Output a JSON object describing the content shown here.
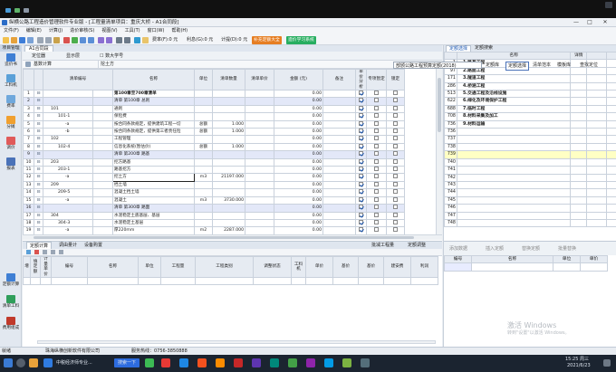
{
  "title_bar": {
    "title": "纵横公路工程造价管理软件专业版 - [工程量清单项目：重庆大桥 - A1合同段]",
    "controls": [
      "—",
      "□",
      "✕"
    ]
  },
  "menu": [
    "文件(F)",
    "编辑(E)",
    "计算(J)",
    "造价审核(S)",
    "视图(V)",
    "工具(T)",
    "窗口(W)",
    "帮助(H)"
  ],
  "toolbar": {
    "rate_label": "费率(F):0 元",
    "interest_label": "利息(G):0 元",
    "deduct_label": "计提(D):0 元",
    "btn_help": "补充定额大全",
    "btn_learn": "造价学习系统"
  },
  "left_nav": {
    "header": "项目管理",
    "items": [
      {
        "label": "造价书",
        "icon": "book-icon"
      },
      {
        "label": "工料机",
        "icon": "cart-icon"
      },
      {
        "label": "费率",
        "icon": "calc-icon"
      },
      {
        "label": "分摊",
        "icon": "share-icon"
      },
      {
        "label": "调价",
        "icon": "adjust-icon"
      },
      {
        "label": "报表",
        "icon": "report-icon"
      }
    ],
    "bottom_items": [
      {
        "label": "定额计算",
        "icon": "quota-icon"
      },
      {
        "label": "清单工料",
        "icon": "list-material-icon"
      },
      {
        "label": "费用组成",
        "icon": "cost-icon"
      }
    ]
  },
  "main": {
    "doc_tab": "A1合同段",
    "subtoolbar": [
      "定位器",
      "显示层",
      "☐ 数大学号"
    ],
    "subtoolbar_right": {
      "quota_select": "部颁公路工程预算定额(2018)",
      "btn_quota_lib": "定额库",
      "tabs": [
        "定额选择",
        "清单范本",
        "模板库",
        "查找定位"
      ]
    },
    "row2": [
      "基数计算",
      "挖土方"
    ],
    "columns": [
      "",
      "清单编号",
      "",
      "名称",
      "单位",
      "清单数量",
      "清单单价",
      "金额 (元)",
      "备注",
      "单价分析",
      "专项暂定",
      "锁定"
    ],
    "rows": [
      {
        "n": "1",
        "code": "",
        "name": "第100章至700章清单",
        "unit": "",
        "qty": "",
        "price": "",
        "amount": "0.00",
        "blue": false,
        "bold": true,
        "c1": true,
        "c2": false,
        "c3": false
      },
      {
        "n": "2",
        "code": "",
        "name": "清单 第100章  总则",
        "unit": "",
        "qty": "",
        "price": "",
        "amount": "0.00",
        "blue": true,
        "c1": true,
        "c2": false,
        "c3": false
      },
      {
        "n": "3",
        "code": "101",
        "name": "通则",
        "unit": "",
        "qty": "",
        "price": "",
        "amount": "0.00",
        "blue": false,
        "c1": true,
        "c2": false,
        "c3": false
      },
      {
        "n": "4",
        "code": "101-1",
        "name": "保险费",
        "unit": "",
        "qty": "",
        "price": "",
        "amount": "0.00",
        "blue": false,
        "c1": true,
        "c2": false,
        "c3": false
      },
      {
        "n": "5",
        "code": "-a",
        "name": "按合同条款规定，提供建筑工程一切",
        "unit": "总额",
        "qty": "1.000",
        "price": "",
        "amount": "0.00",
        "blue": false,
        "c1": true,
        "c2": false,
        "c3": false
      },
      {
        "n": "6",
        "code": "-b",
        "name": "按合同条款规定，提供第三者责任险",
        "unit": "总额",
        "qty": "1.000",
        "price": "",
        "amount": "0.00",
        "blue": false,
        "c1": true,
        "c2": false,
        "c3": false
      },
      {
        "n": "7",
        "code": "102",
        "name": "工程管理",
        "unit": "",
        "qty": "",
        "price": "",
        "amount": "0.00",
        "blue": false,
        "c1": true,
        "c2": false,
        "c3": false
      },
      {
        "n": "8",
        "code": "102-4",
        "name": "信息化系统(暂估价)",
        "unit": "总额",
        "qty": "1.000",
        "price": "",
        "amount": "0.00",
        "blue": false,
        "c1": true,
        "c2": false,
        "c3": false
      },
      {
        "n": "9",
        "code": "",
        "name": "清单 第200章  路基",
        "unit": "",
        "qty": "",
        "price": "",
        "amount": "0.00",
        "blue": true,
        "c1": true,
        "c2": false,
        "c3": false
      },
      {
        "n": "10",
        "code": "203",
        "name": "挖方路基",
        "unit": "",
        "qty": "",
        "price": "",
        "amount": "0.00",
        "blue": false,
        "c1": true,
        "c2": false,
        "c3": false
      },
      {
        "n": "11",
        "code": "203-1",
        "name": "路基挖方",
        "unit": "",
        "qty": "",
        "price": "",
        "amount": "0.00",
        "blue": false,
        "c1": true,
        "c2": false,
        "c3": false
      },
      {
        "n": "12",
        "code": "-a",
        "name": "挖土方",
        "unit": "m3",
        "qty": "21197.000",
        "price": "",
        "amount": "0.00",
        "blue": false,
        "sel": true,
        "c1": true,
        "c2": false,
        "c3": false
      },
      {
        "n": "13",
        "code": "209",
        "name": "挡土墙",
        "unit": "",
        "qty": "",
        "price": "",
        "amount": "0.00",
        "blue": false,
        "c1": true,
        "c2": false,
        "c3": false
      },
      {
        "n": "14",
        "code": "209-5",
        "name": "混凝土挡土墙",
        "unit": "",
        "qty": "",
        "price": "",
        "amount": "0.00",
        "blue": false,
        "c1": true,
        "c2": false,
        "c3": false
      },
      {
        "n": "15",
        "code": "-a",
        "name": "混凝土",
        "unit": "m3",
        "qty": "3730.000",
        "price": "",
        "amount": "0.00",
        "blue": false,
        "c1": true,
        "c2": false,
        "c3": false
      },
      {
        "n": "16",
        "code": "",
        "name": "清单 第300章  路面",
        "unit": "",
        "qty": "",
        "price": "",
        "amount": "0.00",
        "blue": true,
        "c1": true,
        "c2": false,
        "c3": false
      },
      {
        "n": "17",
        "code": "304",
        "name": "水泥稳定土底基层、基层",
        "unit": "",
        "qty": "",
        "price": "",
        "amount": "0.00",
        "blue": false,
        "c1": true,
        "c2": false,
        "c3": false
      },
      {
        "n": "18",
        "code": "304-3",
        "name": "水泥稳定土基层",
        "unit": "",
        "qty": "",
        "price": "",
        "amount": "0.00",
        "blue": false,
        "c1": true,
        "c2": false,
        "c3": false
      },
      {
        "n": "19",
        "code": "-a",
        "name": "厚220mm",
        "unit": "m2",
        "qty": "2287.000",
        "price": "",
        "amount": "0.00",
        "blue": false,
        "c1": true,
        "c2": false,
        "c3": false
      },
      {
        "n": "20",
        "code": "",
        "name": "清单 第400章  桥梁、涵洞",
        "unit": "",
        "qty": "",
        "price": "",
        "amount": "0.00",
        "blue": true,
        "c1": true,
        "c2": false,
        "c3": false
      }
    ],
    "bottom_tabs": [
      "定额计算",
      "调由量计",
      "设备购置"
    ],
    "bottom_right": [
      "批减工程量",
      "定额调整"
    ],
    "bottom_columns": [
      "",
      "",
      "编号",
      "名称",
      "单位",
      "工程量",
      "工程类别",
      "调整状态",
      "工料机",
      "单价",
      "基价",
      "基价",
      "建安费",
      "利润"
    ],
    "bottom_header_small": [
      "增",
      "填定额",
      "计量单价"
    ]
  },
  "right": {
    "tabs": [
      "定额选择",
      "定额搜索"
    ],
    "columns": [
      "",
      "名称",
      "详情"
    ],
    "rows": [
      {
        "id": "1",
        "name": "1.路基工程"
      },
      {
        "id": "97",
        "name": "2.路面工程"
      },
      {
        "id": "171",
        "name": "3.隧道工程"
      },
      {
        "id": "286",
        "name": "4.桥涵工程"
      },
      {
        "id": "513",
        "name": "5.交通工程及沿线设施"
      },
      {
        "id": "622",
        "name": "6.绿化及环境保护工程"
      },
      {
        "id": "688",
        "name": "7.临时工程"
      },
      {
        "id": "708",
        "name": "8.材料采集及加工"
      },
      {
        "id": "736",
        "name": "9.材料运输"
      },
      {
        "id": "736",
        "name": ""
      },
      {
        "id": "737",
        "name": ""
      },
      {
        "id": "738",
        "name": ""
      },
      {
        "id": "739",
        "name": ""
      },
      {
        "id": "740",
        "name": ""
      },
      {
        "id": "741",
        "name": ""
      },
      {
        "id": "742",
        "name": ""
      },
      {
        "id": "743",
        "name": ""
      },
      {
        "id": "744",
        "name": ""
      },
      {
        "id": "745",
        "name": ""
      },
      {
        "id": "746",
        "name": ""
      },
      {
        "id": "747",
        "name": ""
      },
      {
        "id": "748",
        "name": ""
      }
    ],
    "selected_index": 12,
    "bottom_buttons": [
      "添加数据",
      "插入定额",
      "替换定额",
      "批量替换"
    ],
    "bottom_columns": [
      "编号",
      "名称",
      "单位",
      "单价"
    ]
  },
  "status": {
    "left": "就绪",
    "company": "珠海纵横创新软件有限公司",
    "phone": "服务热线：0756-3850888"
  },
  "watermark": {
    "line1": "激活 Windows",
    "line2": "转到\"设置\"以激活 Windows。"
  },
  "taskbar": {
    "search": "搜索一下",
    "active_app": "中税经济师专业...",
    "clock_time": "15:25 周三",
    "clock_date": "2021/6/23"
  }
}
